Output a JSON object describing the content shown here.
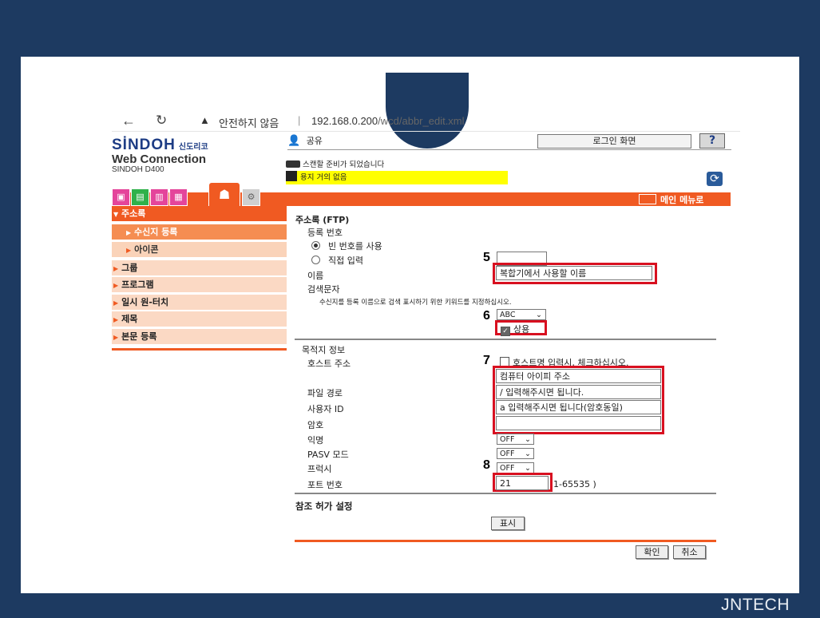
{
  "footer_brand": "JNTECH",
  "browser": {
    "back_icon": "arrow-left-icon",
    "reload_icon": "reload-icon",
    "security_text": "안전하지 않음",
    "url_host": "192.168.0.200",
    "url_path": "/wcd/abbr_edit.xml"
  },
  "header": {
    "brand": "SİNDOH",
    "brand_kr": "신도리코",
    "product": "Web Connection",
    "model": "SINDOH D400",
    "user_label": "공유",
    "login_button": "로그인 화면",
    "help_button": "?",
    "status_scan": "스캔할 준비가 되었습니다",
    "status_paper": "용지 거의 없음"
  },
  "tabs": [
    "box-tab",
    "print-tab",
    "store-tab",
    "scan-tab",
    "address-tab",
    "settings-tab"
  ],
  "main_menu": "메인 메뉴로",
  "sidebar": {
    "address_book": "주소록",
    "recipient_reg": "수신지 등록",
    "icon": "아이콘",
    "group": "그룹",
    "program": "프로그램",
    "one_touch": "일시 원-터치",
    "subject": "제목",
    "body_reg": "본문 등록"
  },
  "form": {
    "title": "주소록 (FTP)",
    "reg_number_label": "등록 번호",
    "option_empty_number": "빈 번호를 사용",
    "option_direct_input": "직접 입력",
    "name_label": "이름",
    "name_value": "복합기에서 사용할 이름",
    "search_label": "검색문자",
    "search_hint": "수신지를 등록 이름으로 검색 표시하기 위한 키워드를 지정하십시오.",
    "index_select": "ABC",
    "frequent_label": "상용",
    "dest_info_label": "목적지 정보",
    "host_label": "호스트 주소",
    "host_check_label": "호스트명 입력시, 체크하십시오.",
    "host_value": "컴퓨터 아이피 주소",
    "path_label": "파일 경로",
    "path_value": "/ 입력해주시면 됩니다.",
    "userid_label": "사용자 ID",
    "userid_value": "a 입력해주시면 됩니다(암호동일)",
    "password_label": "암호",
    "anon_label": "익명",
    "anon_value": "OFF",
    "pasv_label": "PASV 모드",
    "pasv_value": "OFF",
    "proxy_label": "프럭시",
    "proxy_value": "OFF",
    "port_label": "포트 번호",
    "port_value": "21",
    "port_range": "1-65535 )",
    "ref_label": "참조 허가 설정",
    "show_button": "표시",
    "ok_button": "확인",
    "cancel_button": "취소"
  },
  "callouts": {
    "n5": "5",
    "n6": "6",
    "n7": "7",
    "n8": "8"
  },
  "colors": {
    "accent": "#f05a22",
    "frame": "#1d3a61",
    "callout": "#d81020",
    "highlight": "#ffff00"
  }
}
